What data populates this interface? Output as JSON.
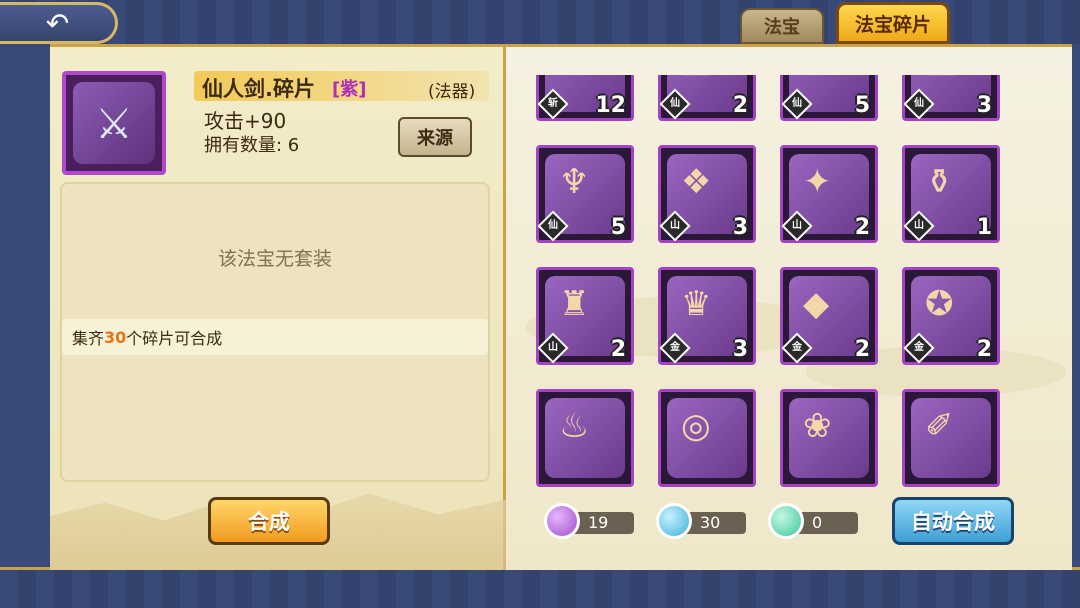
{
  "tabs": [
    {
      "label": "法宝",
      "active": false
    },
    {
      "label": "法宝碎片",
      "active": true
    }
  ],
  "detail": {
    "name": "仙人剑.碎片",
    "quality": "[紫]",
    "item_type": "(法器)",
    "attack": "攻击+90",
    "owned": "拥有数量: 6",
    "source_button": "来源",
    "no_set_text": "该法宝无套装",
    "collect_prefix": "集齐",
    "collect_number": "30",
    "collect_suffix": "个碎片可合成",
    "compose_button": "合成",
    "quality_color": "#b02fb6"
  },
  "fragments": [
    {
      "type": "斩",
      "count": "12",
      "icon": "skull-icon"
    },
    {
      "type": "仙",
      "count": "2",
      "icon": "mirror-icon"
    },
    {
      "type": "仙",
      "count": "5",
      "icon": "scroll-icon"
    },
    {
      "type": "仙",
      "count": "3",
      "icon": "box-icon"
    },
    {
      "type": "仙",
      "count": "5",
      "icon": "robe-icon"
    },
    {
      "type": "山",
      "count": "3",
      "icon": "beads-icon"
    },
    {
      "type": "山",
      "count": "2",
      "icon": "fan-icon"
    },
    {
      "type": "山",
      "count": "1",
      "icon": "gourd-icon"
    },
    {
      "type": "山",
      "count": "2",
      "icon": "cloak-icon"
    },
    {
      "type": "金",
      "count": "3",
      "icon": "crown-icon"
    },
    {
      "type": "金",
      "count": "2",
      "icon": "pendant-icon"
    },
    {
      "type": "金",
      "count": "2",
      "icon": "orb-wand-icon"
    },
    {
      "type": "",
      "count": "",
      "icon": "lantern-icon"
    },
    {
      "type": "",
      "count": "",
      "icon": "ring-icon"
    },
    {
      "type": "",
      "count": "",
      "icon": "ribbon-icon"
    },
    {
      "type": "",
      "count": "",
      "icon": "brush-icon"
    }
  ],
  "resources": [
    {
      "value": "19",
      "color": "#a04ec8",
      "icon": "purple-essence-icon"
    },
    {
      "value": "30",
      "color": "#3fb1d6",
      "icon": "blue-essence-icon"
    },
    {
      "value": "0",
      "color": "#3cc79a",
      "icon": "green-essence-icon"
    }
  ],
  "auto_compose_button": "自动合成"
}
